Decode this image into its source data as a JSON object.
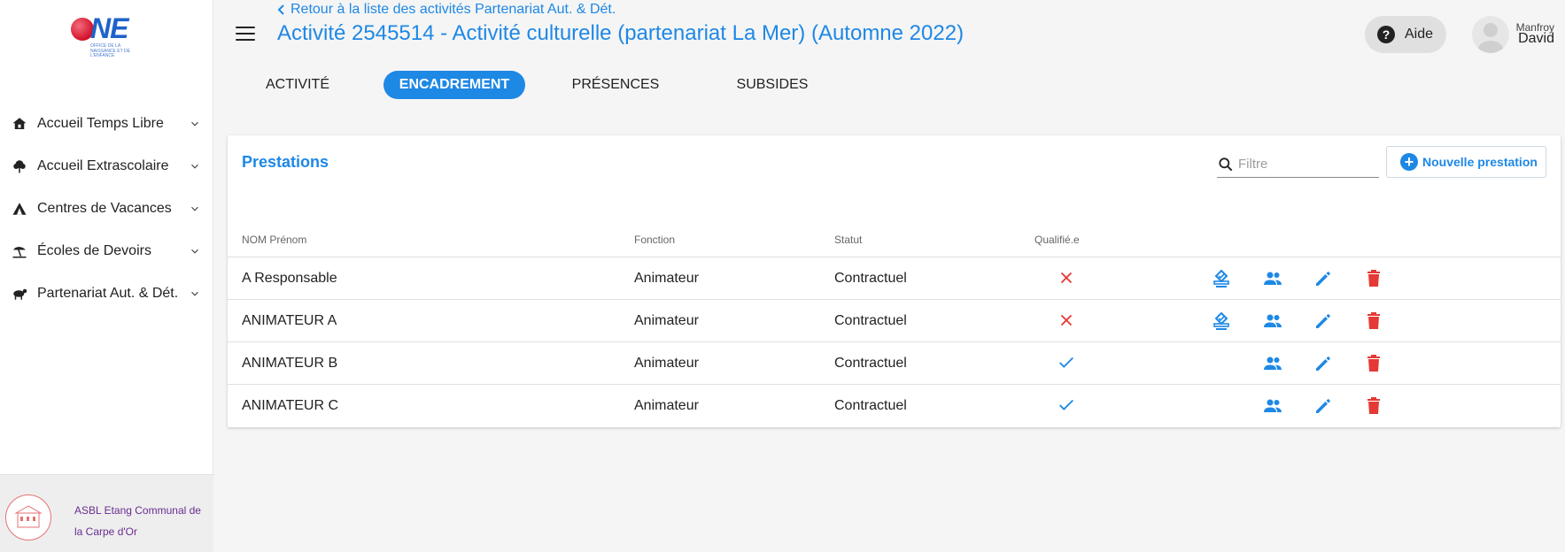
{
  "colors": {
    "accent": "#1e88e5",
    "danger": "#e53935",
    "success": "#1e88e5"
  },
  "logo": {
    "text": "ONE",
    "subtitle": "OFFICE DE LA NAISSANCE ET DE L'ENFANCE"
  },
  "sidebar": {
    "items": [
      {
        "label": "Accueil Temps Libre",
        "icon": "house-icon"
      },
      {
        "label": "Accueil Extrascolaire",
        "icon": "tree-icon"
      },
      {
        "label": "Centres de Vacances",
        "icon": "tent-icon"
      },
      {
        "label": "Écoles de Devoirs",
        "icon": "beach-umbrella-icon"
      },
      {
        "label": "Partenariat Aut. & Dét.",
        "icon": "pet-icon"
      }
    ],
    "organization": "ASBL Etang Communal de la Carpe d'Or"
  },
  "header": {
    "back_label": "Retour à la liste des activités Partenariat Aut. & Dét.",
    "title": "Activité 2545514 - Activité culturelle (partenariat La Mer) (Automne 2022)",
    "help_label": "Aide",
    "user": {
      "first_name": "Manfroy",
      "last_name": "David"
    }
  },
  "tabs": [
    {
      "label": "ACTIVITÉ",
      "active": false
    },
    {
      "label": "ENCADREMENT",
      "active": true
    },
    {
      "label": "PRÉSENCES",
      "active": false
    },
    {
      "label": "SUBSIDES",
      "active": false
    }
  ],
  "card": {
    "title": "Prestations",
    "filter_placeholder": "Filtre",
    "new_button": "Nouvelle prestation",
    "columns": [
      "NOM Prénom",
      "Fonction",
      "Statut",
      "Qualifié.e"
    ],
    "rows": [
      {
        "name": "A Responsable",
        "fonction": "Animateur",
        "statut": "Contractuel",
        "qualified": false,
        "has_validate": true
      },
      {
        "name": "ANIMATEUR A",
        "fonction": "Animateur",
        "statut": "Contractuel",
        "qualified": false,
        "has_validate": true
      },
      {
        "name": "ANIMATEUR B",
        "fonction": "Animateur",
        "statut": "Contractuel",
        "qualified": true,
        "has_validate": false
      },
      {
        "name": "ANIMATEUR C",
        "fonction": "Animateur",
        "statut": "Contractuel",
        "qualified": true,
        "has_validate": false
      }
    ]
  }
}
